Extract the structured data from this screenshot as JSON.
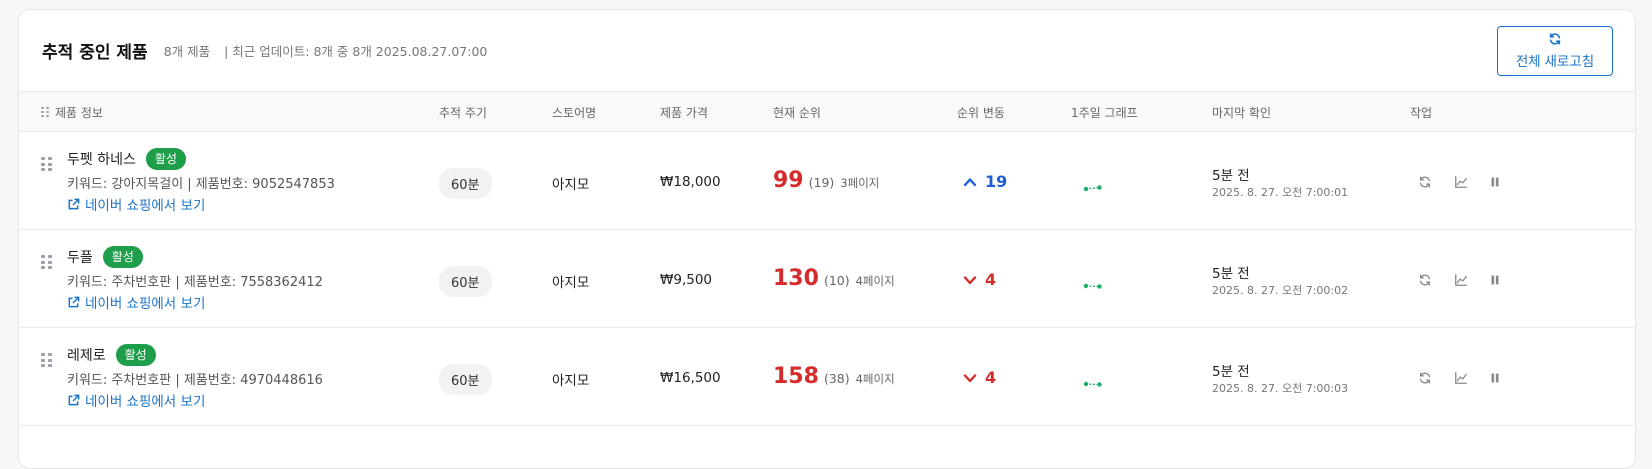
{
  "header": {
    "title": "추적 중인 제품",
    "count": "8개 제품",
    "updated": "| 최근 업데이트: 8개 중 8개 2025.08.27.07:00",
    "refresh_all_label": "전체 새로고침"
  },
  "columns": {
    "product_info": "제품 정보",
    "interval": "추적 주기",
    "store": "스토어명",
    "price": "제품 가격",
    "rank": "현재 순위",
    "change": "순위 변동",
    "graph": "1주일 그래프",
    "last_check": "마지막 확인",
    "actions": "작업"
  },
  "rows": [
    {
      "name": "두펫 하네스",
      "status": "활성",
      "keyword_line": "키워드: 강아지목걸이 | 제품번호: 9052547853",
      "link": "네이버 쇼핑에서 보기",
      "interval": "60분",
      "store": "아지모",
      "price": "₩18,000",
      "rank": "99",
      "rank_in_page": "(19)",
      "page": "3페이지",
      "change_direction": "up",
      "change": "19",
      "last_rel": "5분 전",
      "last_abs": "2025. 8. 27. 오전 7:00:01"
    },
    {
      "name": "두플",
      "status": "활성",
      "keyword_line": "키워드: 주차번호판 | 제품번호: 7558362412",
      "link": "네이버 쇼핑에서 보기",
      "interval": "60분",
      "store": "아지모",
      "price": "₩9,500",
      "rank": "130",
      "rank_in_page": "(10)",
      "page": "4페이지",
      "change_direction": "down",
      "change": "4",
      "last_rel": "5분 전",
      "last_abs": "2025. 8. 27. 오전 7:00:02"
    },
    {
      "name": "레제로",
      "status": "활성",
      "keyword_line": "키워드: 주차번호판 | 제품번호: 4970448616",
      "link": "네이버 쇼핑에서 보기",
      "interval": "60분",
      "store": "아지모",
      "price": "₩16,500",
      "rank": "158",
      "rank_in_page": "(38)",
      "page": "4페이지",
      "change_direction": "down",
      "change": "4",
      "last_rel": "5분 전",
      "last_abs": "2025. 8. 27. 오전 7:00:03"
    }
  ],
  "icons": {
    "refresh": "refresh-icon",
    "chart": "line-chart-icon",
    "pause": "pause-icon",
    "external": "external-link-icon",
    "drag": "drag-handle-icon"
  },
  "colors": {
    "accent": "#1a73c8",
    "active_badge": "#1e9e4a",
    "rank_red": "#d62b2b",
    "up_blue": "#1a5fd6",
    "sparkline": "#1eae6a"
  }
}
